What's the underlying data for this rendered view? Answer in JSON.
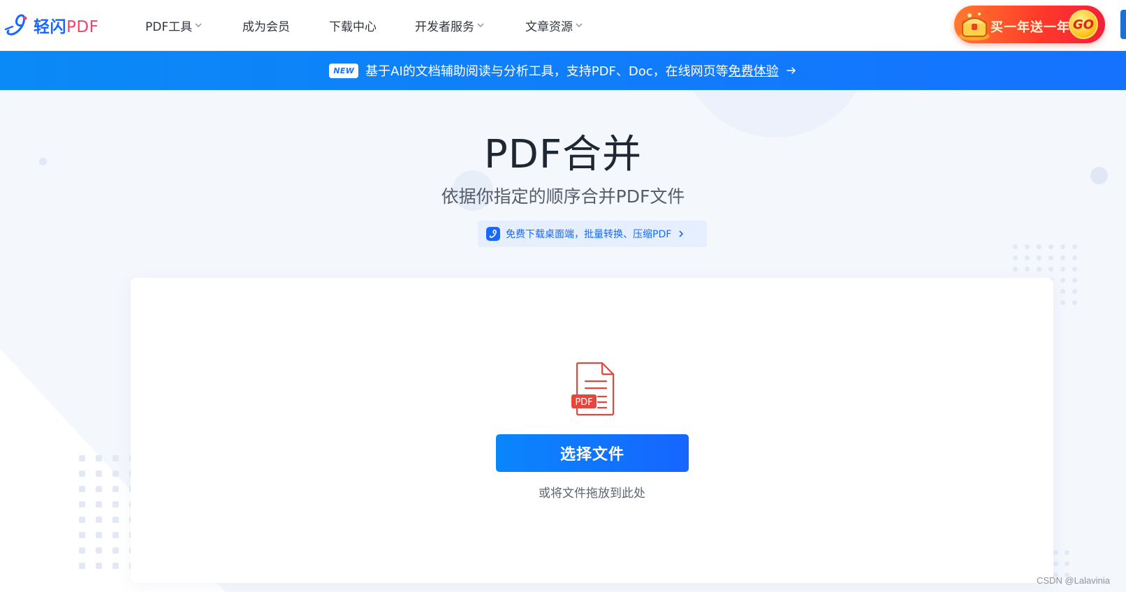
{
  "brand": {
    "logo_cn": "轻闪",
    "logo_pdf": "PDF"
  },
  "nav": {
    "items": [
      {
        "label": "PDF工具",
        "has_dropdown": true
      },
      {
        "label": "成为会员",
        "has_dropdown": false
      },
      {
        "label": "下载中心",
        "has_dropdown": false
      },
      {
        "label": "开发者服务",
        "has_dropdown": true
      },
      {
        "label": "文章资源",
        "has_dropdown": true
      }
    ]
  },
  "promo": {
    "text": "买一年送一年",
    "go": "GO"
  },
  "banner": {
    "badge": "NEW",
    "text": "基于AI的文档辅助阅读与分析工具，支持PDF、Doc，在线网页等",
    "link": "免费体验",
    "arrow_icon": "arrow-right-icon"
  },
  "hero": {
    "title": "PDF合并",
    "subtitle": "依据你指定的顺序合并PDF文件",
    "download_pill": "免费下载桌面端，批量转换、压缩PDF"
  },
  "upload": {
    "file_badge": "PDF",
    "select_button": "选择文件",
    "drop_hint": "或将文件拖放到此处"
  },
  "watermark": "CSDN @Lalavinia",
  "colors": {
    "brand_blue": "#1668ff",
    "banner_blue": "#0a8af6",
    "brand_pink": "#ff3d6b",
    "pdf_red": "#e8453c",
    "promo_red": "#ff3b2a",
    "page_bg": "#f4f7fc"
  }
}
